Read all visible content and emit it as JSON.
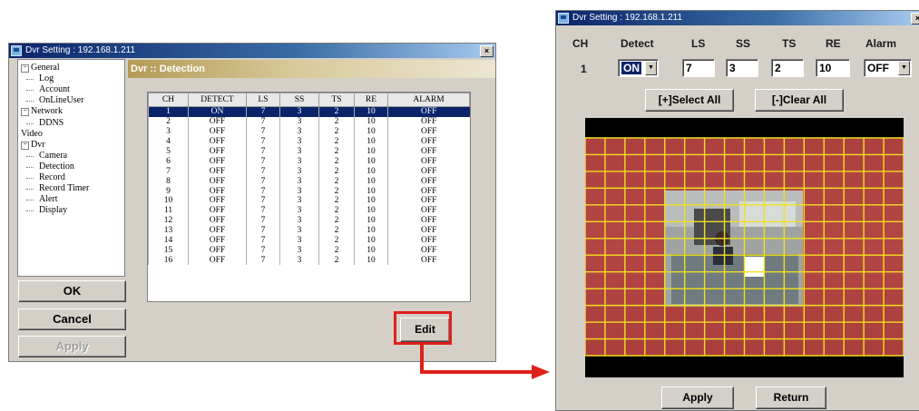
{
  "left_window": {
    "title": "Dvr Setting : 192.168.1.211",
    "close": "×",
    "tree": [
      {
        "label": "General",
        "toggle": "⊟",
        "level": 0
      },
      {
        "label": "Log",
        "level": 1
      },
      {
        "label": "Account",
        "level": 1
      },
      {
        "label": "OnLineUser",
        "level": 1
      },
      {
        "label": "Network",
        "toggle": "⊟",
        "level": 0
      },
      {
        "label": "DDNS",
        "level": 1
      },
      {
        "label": "Video",
        "level": 0
      },
      {
        "label": "Dvr",
        "toggle": "⊟",
        "level": 0
      },
      {
        "label": "Camera",
        "level": 1
      },
      {
        "label": "Detection",
        "level": 1
      },
      {
        "label": "Record",
        "level": 1
      },
      {
        "label": "Record Timer",
        "level": 1
      },
      {
        "label": "Alert",
        "level": 1
      },
      {
        "label": "Display",
        "level": 1
      }
    ],
    "header": "Dvr :: Detection",
    "columns": [
      "CH",
      "DETECT",
      "LS",
      "SS",
      "TS",
      "RE",
      "ALARM"
    ],
    "rows": [
      [
        "1",
        "ON",
        "7",
        "3",
        "2",
        "10",
        "OFF"
      ],
      [
        "2",
        "OFF",
        "7",
        "3",
        "2",
        "10",
        "OFF"
      ],
      [
        "3",
        "OFF",
        "7",
        "3",
        "2",
        "10",
        "OFF"
      ],
      [
        "4",
        "OFF",
        "7",
        "3",
        "2",
        "10",
        "OFF"
      ],
      [
        "5",
        "OFF",
        "7",
        "3",
        "2",
        "10",
        "OFF"
      ],
      [
        "6",
        "OFF",
        "7",
        "3",
        "2",
        "10",
        "OFF"
      ],
      [
        "7",
        "OFF",
        "7",
        "3",
        "2",
        "10",
        "OFF"
      ],
      [
        "8",
        "OFF",
        "7",
        "3",
        "2",
        "10",
        "OFF"
      ],
      [
        "9",
        "OFF",
        "7",
        "3",
        "2",
        "10",
        "OFF"
      ],
      [
        "10",
        "OFF",
        "7",
        "3",
        "2",
        "10",
        "OFF"
      ],
      [
        "11",
        "OFF",
        "7",
        "3",
        "2",
        "10",
        "OFF"
      ],
      [
        "12",
        "OFF",
        "7",
        "3",
        "2",
        "10",
        "OFF"
      ],
      [
        "13",
        "OFF",
        "7",
        "3",
        "2",
        "10",
        "OFF"
      ],
      [
        "14",
        "OFF",
        "7",
        "3",
        "2",
        "10",
        "OFF"
      ],
      [
        "15",
        "OFF",
        "7",
        "3",
        "2",
        "10",
        "OFF"
      ],
      [
        "16",
        "OFF",
        "7",
        "3",
        "2",
        "10",
        "OFF"
      ]
    ],
    "selected_row": 0,
    "ok": "OK",
    "cancel": "Cancel",
    "apply": "Apply",
    "edit": "Edit"
  },
  "right_window": {
    "title": "Dvr Setting : 192.168.1.211",
    "close": "×",
    "labels": {
      "ch": "CH",
      "detect": "Detect",
      "ls": "LS",
      "ss": "SS",
      "ts": "TS",
      "re": "RE",
      "alarm": "Alarm"
    },
    "values": {
      "ch": "1",
      "detect": "ON",
      "ls": "7",
      "ss": "3",
      "ts": "2",
      "re": "10",
      "alarm": "OFF"
    },
    "select_all": "[+]Select All",
    "clear_all": "[-]Clear All",
    "apply": "Apply",
    "return": "Return",
    "grid_cols": 16,
    "grid_rows": 13
  },
  "colors": {
    "highlight": "#e0201a",
    "grid_line": "#f0e020",
    "grid_fill": "#b03a3a",
    "title_bar": "#0a246a"
  }
}
